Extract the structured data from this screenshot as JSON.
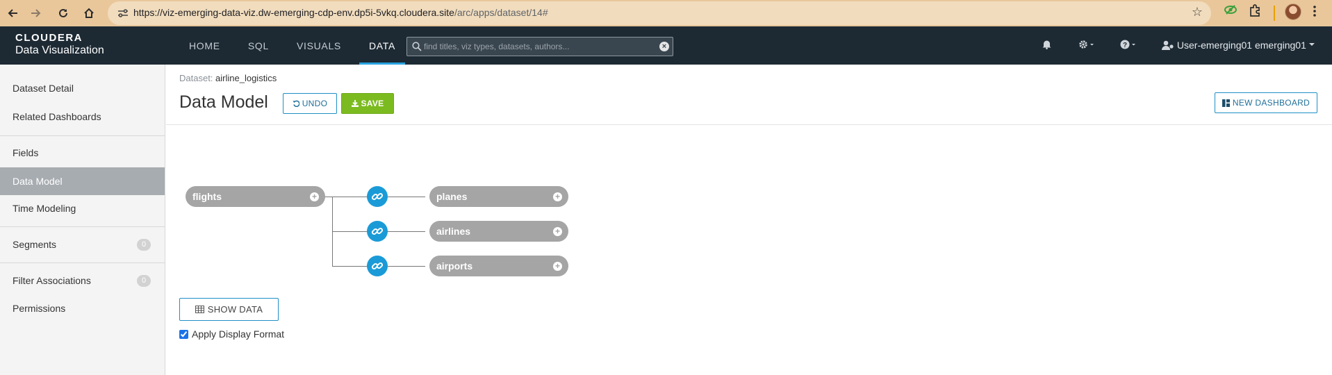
{
  "browser": {
    "url_host": "https://viz-emerging-data-viz.dw-emerging-cdp-env.dp5i-5vkq.cloudera.site",
    "url_path": "/arc/apps/dataset/14#",
    "icons": [
      "back-icon",
      "forward-icon",
      "reload-icon",
      "home-icon",
      "site-info-icon",
      "bookmark-star-icon",
      "extension-eye-icon",
      "extensions-puzzle-icon",
      "profile-avatar",
      "kebab-menu-icon"
    ]
  },
  "app": {
    "logo_line1": "CLOUDERA",
    "logo_line2": "Data Visualization",
    "nav": [
      {
        "label": "HOME",
        "active": false
      },
      {
        "label": "SQL",
        "active": false
      },
      {
        "label": "VISUALS",
        "active": false
      },
      {
        "label": "DATA",
        "active": true
      }
    ],
    "search": {
      "placeholder": "find titles, viz types, datasets, authors..."
    },
    "user": "User-emerging01 emerging01",
    "accent_color": "#29a3e0"
  },
  "sidebar": {
    "items": [
      {
        "label": "Dataset Detail"
      },
      {
        "label": "Related Dashboards"
      },
      {
        "label": "Fields"
      },
      {
        "label": "Data Model",
        "active": true
      },
      {
        "label": "Time Modeling"
      },
      {
        "label": "Segments",
        "badge": "0"
      },
      {
        "label": "Filter Associations",
        "badge": "0"
      },
      {
        "label": "Permissions"
      }
    ]
  },
  "main": {
    "crumb_label": "Dataset:",
    "crumb_value": "airline_logistics",
    "title": "Data Model",
    "undo_label": "UNDO",
    "save_label": "SAVE",
    "new_dashboard_label": "NEW DASHBOARD",
    "model": {
      "primary_table": "flights",
      "joined_tables": [
        "planes",
        "airlines",
        "airports"
      ]
    },
    "show_data_label": "SHOW DATA",
    "apply_display_format_label": "Apply Display Format",
    "apply_display_format_checked": true
  }
}
